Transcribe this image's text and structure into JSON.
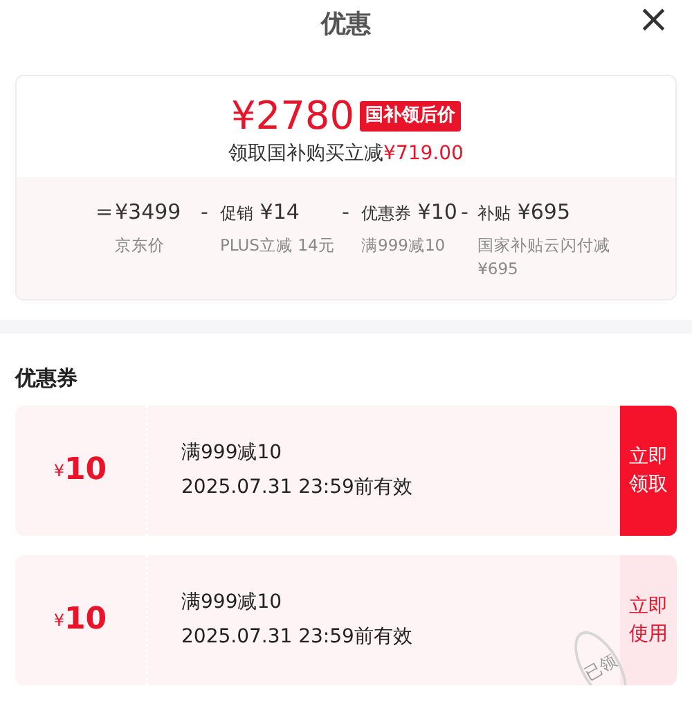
{
  "header": {
    "title": "优惠",
    "close": "×"
  },
  "summary": {
    "price": "¥2780",
    "price_tag": "国补领后价",
    "subtitle_text": "领取国补购买立减",
    "subtitle_amount": "¥719.00",
    "breakdown": [
      {
        "op": "=",
        "amount": "¥3499",
        "desc": "京东价"
      },
      {
        "op": "-",
        "label": "促销",
        "amount": "¥14",
        "desc": "PLUS立减 14元"
      },
      {
        "op": "-",
        "label": "优惠券",
        "amount": "¥10",
        "desc": "满999减10"
      },
      {
        "op": "-",
        "label": "补贴",
        "amount": "¥695",
        "desc": "国家补贴云闪付减¥695"
      }
    ]
  },
  "coupons_section": {
    "title": "优惠券",
    "coupons": [
      {
        "currency": "¥",
        "value": "10",
        "condition": "满999减10",
        "validity": "2025.07.31 23:59前有效",
        "action": "立即领取",
        "claimed": false
      },
      {
        "currency": "¥",
        "value": "10",
        "condition": "满999减10",
        "validity": "2025.07.31 23:59前有效",
        "action": "立即使用",
        "claimed": true,
        "stamp": "已领"
      }
    ]
  }
}
